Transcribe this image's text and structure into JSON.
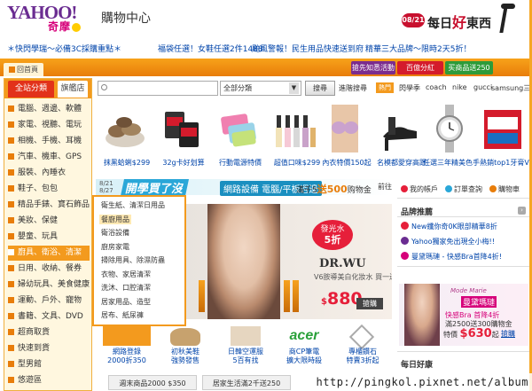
{
  "header": {
    "logo_text": "YAHOO!",
    "logo_sub": "奇摩",
    "site_title": "購物中心",
    "daily_date": "08/21",
    "daily_label_a": "每日",
    "daily_label_hl": "好",
    "daily_label_b": "東西"
  },
  "promo_links": [
    "＊快閃學瑞～必備3C採購重點＊",
    "福袋任選！女鞋任選2件1488",
    "颱風警報！民生用品快速送到府",
    "精華三大品牌～限時2天5折！"
  ],
  "nav": {
    "home": "回首頁",
    "tab_vip": "搶先知悉活動",
    "tab_hundred": "百億分紅",
    "tab_free": "买商品送250"
  },
  "sidebar": {
    "tab_all": "全站分類",
    "tab_store": "旗艦店",
    "categories": [
      "電腦、週邊、軟體",
      "家電、視聽、電玩",
      "相機、手機、耳機",
      "汽車、機車、GPS",
      "服裝、內睡衣",
      "鞋子、包包",
      "精品手錶、寶石飾品",
      "美妝、保健",
      "嬰童、玩具",
      "廚具、衛浴、清潔",
      "日用、收納、餐券",
      "婦幼玩具、美食健康",
      "運動、戶外、寵物",
      "書籍、文具、DVD",
      "超商取貨",
      "快速到貨",
      "型男館",
      "悠遊區"
    ],
    "active_index": 9
  },
  "search": {
    "placeholder": "",
    "category": "全部分類",
    "button": "搜尋",
    "advanced": "進階搜尋",
    "hot_label": "熱門",
    "keywords": [
      "閃學季",
      "coach",
      "nike",
      "gucci",
      "samsung三星"
    ]
  },
  "products": [
    "抹黑蛤蜊$299",
    "32g卡好划算",
    "行動電源特價",
    "超值口味$299",
    "內衣特價150起",
    "名模都愛穿高跟",
    "任選三年精美色手",
    "熱銷top1牙膏V"
  ],
  "band": {
    "date_a": "8/21",
    "date_b": "8/27",
    "headline": "開學買了沒",
    "middle": "網路設備 電腦/平板週邊",
    "rebate_prefix": "滿千5",
    "rebate_value": "送500",
    "rebate_suffix": "购物金",
    "go": "前往"
  },
  "submenu": [
    "衛生紙、清潔日用品",
    "餐廚用品",
    "衛浴設備",
    "廚房家電",
    "掃除用具、除濕防蟲",
    "衣物、家居清潔",
    "洗沐、口腔清潔",
    "居家用品、造型",
    "居布、紙尿褲"
  ],
  "submenu_highlight": 1,
  "banner": {
    "badge_a": "發光水",
    "badge_b": "5折",
    "brand": "DR.WU",
    "brand_sub": "V6胺導美白化妝水 買一送一",
    "price": "880",
    "currency": "$",
    "rush": "搶購"
  },
  "tiles": [
    {
      "a": "網路登錄",
      "b": "2000折350"
    },
    {
      "a": "初秋美鞋",
      "b": "強勢發售"
    },
    {
      "a": "日韓空運服",
      "b": "5百有找"
    },
    {
      "a": "商CP筆電",
      "b": "擴大限時殺"
    },
    {
      "a": "專櫃鑽石",
      "b": "特賣3折起"
    }
  ],
  "bottom_tabs": [
    "週末商品2000 $350",
    "居家生活滿2千送250"
  ],
  "right": {
    "links": [
      "我的帳戶",
      "訂單查詢",
      "購物車"
    ],
    "brand_title": "品牌推薦",
    "news": [
      "New纖你奇0K眼部精華8折",
      "Yahoo獨家免出現全小梅!!",
      "曼黛瑪璉 - 快感Bra首降4折!"
    ],
    "ad_brand": "Mode Marie",
    "ad_name": "曼黛瑪璉",
    "ad_line1": "快感Bra 首降4折",
    "ad_line2": "滿2500送300購物金",
    "price_label": "特價",
    "price": "$630",
    "price_suffix": "起",
    "rush": "搶購",
    "daily_title": "每日好康"
  },
  "watermark": "http://pingkol.pixnet.net/album"
}
